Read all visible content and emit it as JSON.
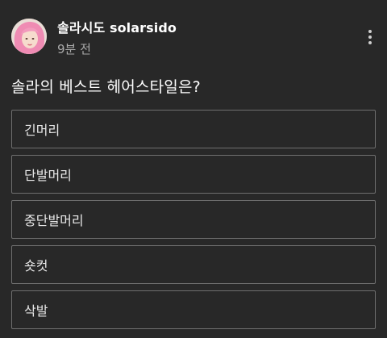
{
  "post": {
    "channel_name": "솔라시도 solarsido",
    "time": "9분 전",
    "question": "솔라의 베스트 헤어스타일은?",
    "options": [
      {
        "label": "긴머리"
      },
      {
        "label": "단발머리"
      },
      {
        "label": "중단발머리"
      },
      {
        "label": "숏컷"
      },
      {
        "label": "삭발"
      }
    ]
  },
  "icons": {
    "more": "more-vertical-icon",
    "avatar": "channel-avatar"
  },
  "colors": {
    "background": "#282828",
    "text": "#ffffff",
    "secondary_text": "#aaaaaa",
    "option_border": "#6f6f6f"
  }
}
